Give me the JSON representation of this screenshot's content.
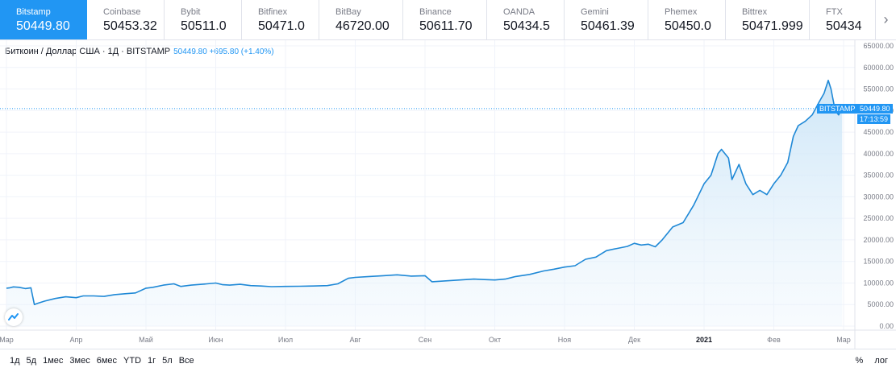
{
  "exchanges": [
    {
      "name": "Bitstamp",
      "price": "50449.80",
      "active": true
    },
    {
      "name": "Coinbase",
      "price": "50453.32"
    },
    {
      "name": "Bybit",
      "price": "50511.0"
    },
    {
      "name": "Bitfinex",
      "price": "50471.0"
    },
    {
      "name": "BitBay",
      "price": "46720.00"
    },
    {
      "name": "Binance",
      "price": "50611.70"
    },
    {
      "name": "OANDA",
      "price": "50434.5"
    },
    {
      "name": "Gemini",
      "price": "50461.39"
    },
    {
      "name": "Phemex",
      "price": "50450.0"
    },
    {
      "name": "Bittrex",
      "price": "50471.999"
    },
    {
      "name": "FTX",
      "price": "50434"
    }
  ],
  "exchange_next_icon": "chevron-right-icon",
  "legend": {
    "symbol": "Биткоин / Доллар США · 1Д · BITSTAMP",
    "values": "50449.80 +695.80 (+1.40%)"
  },
  "price_tag": {
    "exchange": "BITSTAMP",
    "price": "50449.80",
    "countdown": "17:13:59"
  },
  "colors": {
    "accent": "#2196f3",
    "line": "#1e88d6",
    "fill_top": "#cbe5f7",
    "grid": "#f0f3fa",
    "text_muted": "#787b86"
  },
  "bottom_ranges": [
    "1д",
    "5д",
    "1мес",
    "3мес",
    "6мес",
    "YTD",
    "1г",
    "5л",
    "Все"
  ],
  "bottom_right": {
    "percent": "%",
    "log": "лог"
  },
  "chart_data": {
    "type": "area",
    "y_tick_labels": [
      "65000.00",
      "60000.00",
      "55000.00",
      "50000.00",
      "45000.00",
      "40000.00",
      "35000.00",
      "30000.00",
      "25000.00",
      "20000.00",
      "15000.00",
      "10000.00",
      "5000.00",
      "0.00"
    ],
    "x_tick_labels": [
      "Мар",
      "Апр",
      "Май",
      "Июн",
      "Июл",
      "Авг",
      "Сен",
      "Окт",
      "Ноя",
      "Дек",
      "2021",
      "Фев",
      "Мар"
    ],
    "ylim": [
      0,
      65000
    ],
    "x_months_start": "2020-03-01",
    "x_months_end": "2021-03-01",
    "series": [
      {
        "values": [
          [
            0.0,
            8800
          ],
          [
            0.05,
            8900
          ],
          [
            0.1,
            9100
          ],
          [
            0.18,
            9000
          ],
          [
            0.27,
            8700
          ],
          [
            0.35,
            8900
          ],
          [
            0.4,
            5000
          ],
          [
            0.45,
            5300
          ],
          [
            0.55,
            5800
          ],
          [
            0.7,
            6400
          ],
          [
            0.85,
            6800
          ],
          [
            1.0,
            6600
          ],
          [
            1.1,
            7000
          ],
          [
            1.25,
            7000
          ],
          [
            1.4,
            6900
          ],
          [
            1.55,
            7300
          ],
          [
            1.7,
            7500
          ],
          [
            1.85,
            7700
          ],
          [
            2.0,
            8800
          ],
          [
            2.1,
            9000
          ],
          [
            2.25,
            9500
          ],
          [
            2.4,
            9800
          ],
          [
            2.5,
            9200
          ],
          [
            2.65,
            9500
          ],
          [
            2.8,
            9700
          ],
          [
            3.0,
            10000
          ],
          [
            3.1,
            9600
          ],
          [
            3.2,
            9500
          ],
          [
            3.35,
            9700
          ],
          [
            3.5,
            9400
          ],
          [
            3.65,
            9300
          ],
          [
            3.8,
            9150
          ],
          [
            4.0,
            9200
          ],
          [
            4.2,
            9250
          ],
          [
            4.4,
            9300
          ],
          [
            4.6,
            9400
          ],
          [
            4.75,
            9800
          ],
          [
            4.9,
            11100
          ],
          [
            5.0,
            11300
          ],
          [
            5.2,
            11500
          ],
          [
            5.4,
            11700
          ],
          [
            5.6,
            11900
          ],
          [
            5.8,
            11600
          ],
          [
            6.0,
            11700
          ],
          [
            6.1,
            10300
          ],
          [
            6.3,
            10500
          ],
          [
            6.5,
            10700
          ],
          [
            6.7,
            10900
          ],
          [
            6.85,
            10800
          ],
          [
            7.0,
            10700
          ],
          [
            7.15,
            10900
          ],
          [
            7.3,
            11500
          ],
          [
            7.5,
            12000
          ],
          [
            7.7,
            12800
          ],
          [
            7.85,
            13200
          ],
          [
            8.0,
            13700
          ],
          [
            8.15,
            14000
          ],
          [
            8.3,
            15500
          ],
          [
            8.45,
            16000
          ],
          [
            8.6,
            17500
          ],
          [
            8.75,
            18000
          ],
          [
            8.9,
            18500
          ],
          [
            9.0,
            19200
          ],
          [
            9.1,
            18800
          ],
          [
            9.2,
            19000
          ],
          [
            9.3,
            18400
          ],
          [
            9.4,
            20000
          ],
          [
            9.55,
            23000
          ],
          [
            9.7,
            24000
          ],
          [
            9.85,
            28000
          ],
          [
            10.0,
            33000
          ],
          [
            10.1,
            35000
          ],
          [
            10.2,
            40000
          ],
          [
            10.25,
            41000
          ],
          [
            10.35,
            39000
          ],
          [
            10.4,
            34000
          ],
          [
            10.5,
            37500
          ],
          [
            10.6,
            33000
          ],
          [
            10.7,
            30500
          ],
          [
            10.8,
            31500
          ],
          [
            10.9,
            30500
          ],
          [
            11.0,
            33000
          ],
          [
            11.1,
            35000
          ],
          [
            11.2,
            38000
          ],
          [
            11.28,
            44000
          ],
          [
            11.35,
            46500
          ],
          [
            11.45,
            47500
          ],
          [
            11.55,
            49000
          ],
          [
            11.65,
            52000
          ],
          [
            11.72,
            54000
          ],
          [
            11.78,
            57000
          ],
          [
            11.82,
            55000
          ],
          [
            11.88,
            50000
          ],
          [
            11.93,
            49000
          ],
          [
            11.98,
            50449.8
          ]
        ]
      }
    ],
    "last_price": 50449.8
  }
}
